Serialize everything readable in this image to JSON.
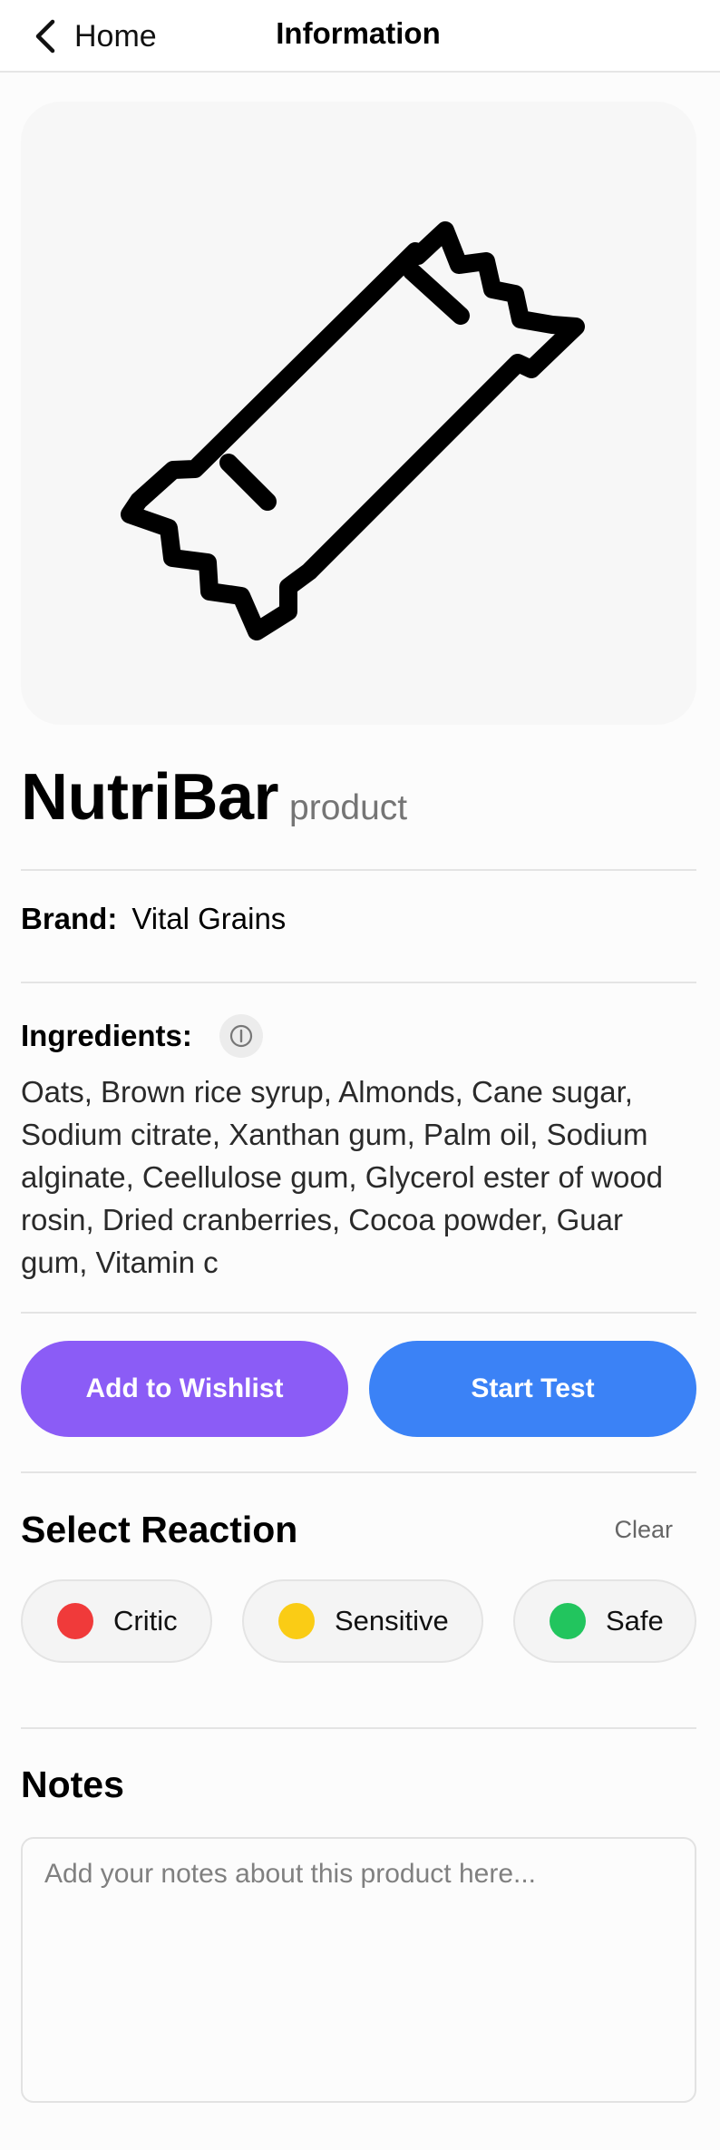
{
  "nav": {
    "back_label": "Home",
    "title": "Information"
  },
  "hero": {
    "icon": "snack-bar-icon"
  },
  "product": {
    "name": "NutriBar",
    "kind": "product",
    "brand_label": "Brand:",
    "brand": "Vital Grains",
    "ingredients_label": "Ingredients:",
    "ingredients": "Oats, Brown rice syrup, Almonds, Cane sugar, Sodium citrate, Xanthan gum, Palm oil, Sodium alginate, Ceellulose gum, Glycerol ester of wood rosin, Dried cranberries, Cocoa powder, Guar gum, Vitamin c"
  },
  "actions": {
    "wishlist_label": "Add to Wishlist",
    "test_label": "Start Test",
    "wishlist_color": "#8b5cf6",
    "test_color": "#3b82f6"
  },
  "reaction": {
    "title": "Select Reaction",
    "clear_label": "Clear",
    "options": [
      {
        "label": "Critic",
        "color": "#f03a3a"
      },
      {
        "label": "Sensitive",
        "color": "#facc15"
      },
      {
        "label": "Safe",
        "color": "#22c55e"
      }
    ]
  },
  "notes": {
    "title": "Notes",
    "placeholder": "Add your notes about this product here..."
  }
}
